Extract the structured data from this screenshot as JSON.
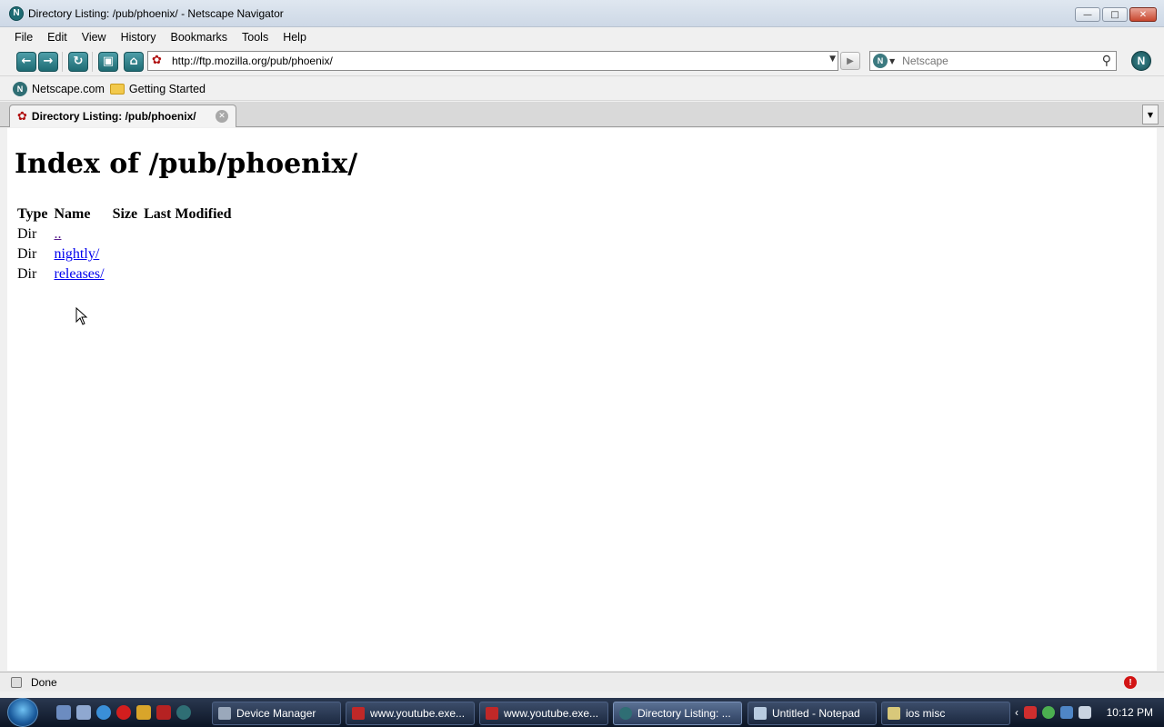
{
  "window": {
    "title": "Directory Listing: /pub/phoenix/ - Netscape Navigator",
    "app_icon": "N"
  },
  "menu": [
    "File",
    "Edit",
    "View",
    "History",
    "Bookmarks",
    "Tools",
    "Help"
  ],
  "navigation": {
    "url": "http://ftp.mozilla.org/pub/phoenix/",
    "search_placeholder": "Netscape"
  },
  "bookmarks": [
    {
      "label": "Netscape.com",
      "icon": "netscape-icon"
    },
    {
      "label": "Getting Started",
      "icon": "folder-icon"
    }
  ],
  "tab": {
    "label": "Directory Listing: /pub/phoenix/"
  },
  "page": {
    "heading": "Index of /pub/phoenix/",
    "columns": [
      "Type",
      "Name",
      "Size",
      "Last Modified"
    ],
    "rows": [
      {
        "type": "Dir",
        "name": ".."
      },
      {
        "type": "Dir",
        "name": "nightly/"
      },
      {
        "type": "Dir",
        "name": "releases/"
      }
    ]
  },
  "status": {
    "text": "Done"
  },
  "taskbar": {
    "buttons": [
      {
        "label": "Device Manager"
      },
      {
        "label": "www.youtube.exe..."
      },
      {
        "label": "www.youtube.exe..."
      },
      {
        "label": "Directory Listing: ..."
      },
      {
        "label": "Untitled - Notepad"
      },
      {
        "label": "ios misc"
      }
    ],
    "clock": "10:12 PM"
  },
  "colors": {
    "link": "#0000ee",
    "visited_link": "#551a8b",
    "netscape_teal": "#1e6b73"
  }
}
